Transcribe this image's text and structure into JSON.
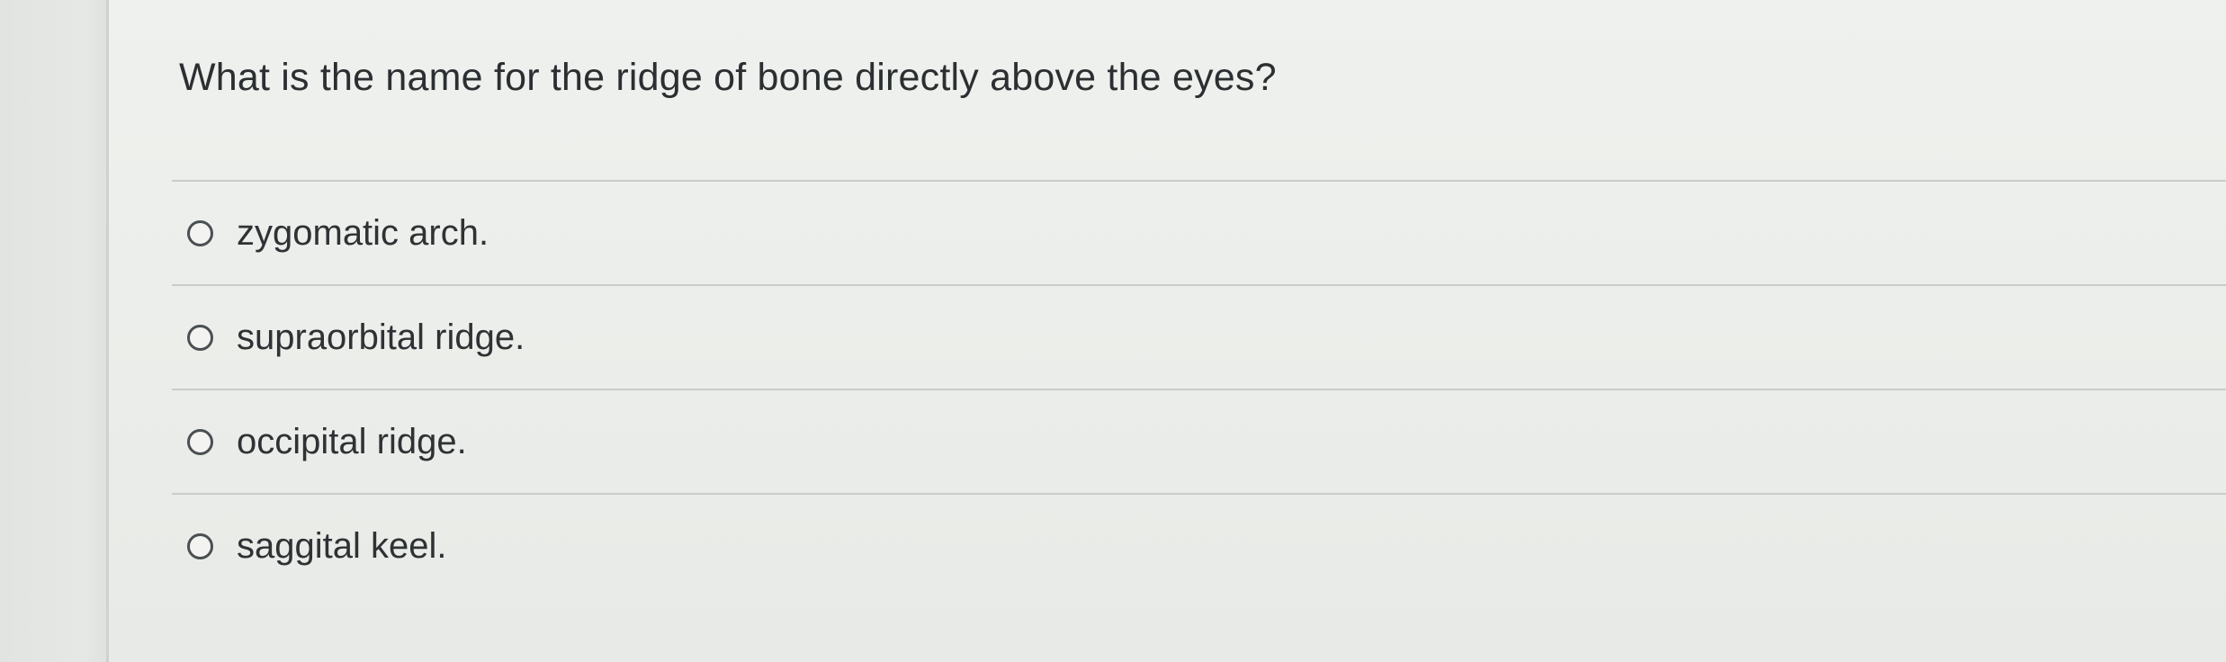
{
  "question": {
    "text": "What is the name for the ridge of bone directly above the eyes?"
  },
  "options": [
    {
      "label": "zygomatic arch."
    },
    {
      "label": "supraorbital ridge."
    },
    {
      "label": "occipital ridge."
    },
    {
      "label": "saggital keel."
    }
  ],
  "colors": {
    "page_background": "#e9ebe8",
    "divider": "#c9ccc8",
    "text": "#2e3234"
  }
}
